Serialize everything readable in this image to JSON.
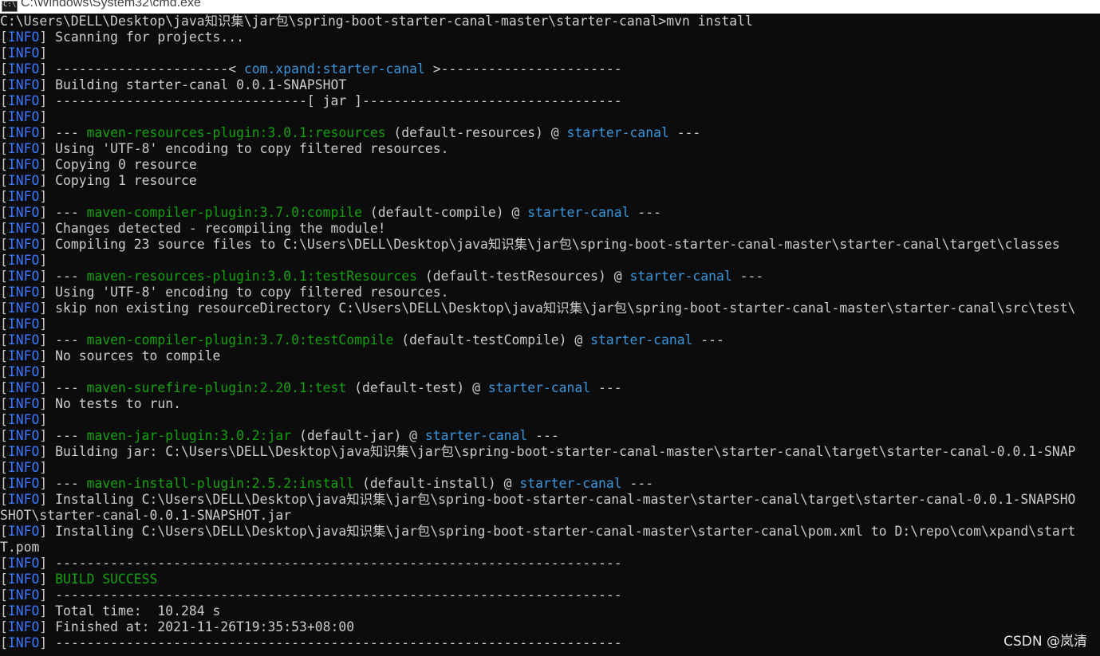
{
  "window": {
    "title": "C:\\Windows\\System32\\cmd.exe",
    "icon": "cmd-icon"
  },
  "colors": {
    "background": "#0c0c0c",
    "text": "#cccccc",
    "info": "#3b78ff",
    "plugin": "#13a10e",
    "artifact": "#3a96dd"
  },
  "console": {
    "lines": [
      {
        "segs": [
          {
            "t": "C:\\Users\\DELL\\Desktop\\java知识集\\jar包\\spring-boot-starter-canal-master\\starter-canal>mvn install",
            "c": "white"
          }
        ]
      },
      {
        "info": true,
        "segs": [
          {
            "t": " Scanning for projects...",
            "c": "white"
          }
        ]
      },
      {
        "info": true,
        "segs": []
      },
      {
        "info": true,
        "segs": [
          {
            "t": " ----------------------< ",
            "c": "white"
          },
          {
            "t": "com.xpand:starter-canal",
            "c": "cyan"
          },
          {
            "t": " >-----------------------",
            "c": "white"
          }
        ]
      },
      {
        "info": true,
        "segs": [
          {
            "t": " Building starter-canal 0.0.1-SNAPSHOT",
            "c": "white"
          }
        ]
      },
      {
        "info": true,
        "segs": [
          {
            "t": " --------------------------------[ jar ]---------------------------------",
            "c": "white"
          }
        ]
      },
      {
        "info": true,
        "segs": []
      },
      {
        "info": true,
        "segs": [
          {
            "t": " --- ",
            "c": "white"
          },
          {
            "t": "maven-resources-plugin:3.0.1:resources",
            "c": "green"
          },
          {
            "t": " (default-resources) @ ",
            "c": "white"
          },
          {
            "t": "starter-canal",
            "c": "cyan"
          },
          {
            "t": " ---",
            "c": "white"
          }
        ]
      },
      {
        "info": true,
        "segs": [
          {
            "t": " Using 'UTF-8' encoding to copy filtered resources.",
            "c": "white"
          }
        ]
      },
      {
        "info": true,
        "segs": [
          {
            "t": " Copying 0 resource",
            "c": "white"
          }
        ]
      },
      {
        "info": true,
        "segs": [
          {
            "t": " Copying 1 resource",
            "c": "white"
          }
        ]
      },
      {
        "info": true,
        "segs": []
      },
      {
        "info": true,
        "segs": [
          {
            "t": " --- ",
            "c": "white"
          },
          {
            "t": "maven-compiler-plugin:3.7.0:compile",
            "c": "green"
          },
          {
            "t": " (default-compile) @ ",
            "c": "white"
          },
          {
            "t": "starter-canal",
            "c": "cyan"
          },
          {
            "t": " ---",
            "c": "white"
          }
        ]
      },
      {
        "info": true,
        "segs": [
          {
            "t": " Changes detected - recompiling the module!",
            "c": "white"
          }
        ]
      },
      {
        "info": true,
        "segs": [
          {
            "t": " Compiling 23 source files to C:\\Users\\DELL\\Desktop\\java知识集\\jar包\\spring-boot-starter-canal-master\\starter-canal\\target\\classes",
            "c": "white"
          }
        ]
      },
      {
        "info": true,
        "segs": []
      },
      {
        "info": true,
        "segs": [
          {
            "t": " --- ",
            "c": "white"
          },
          {
            "t": "maven-resources-plugin:3.0.1:testResources",
            "c": "green"
          },
          {
            "t": " (default-testResources) @ ",
            "c": "white"
          },
          {
            "t": "starter-canal",
            "c": "cyan"
          },
          {
            "t": " ---",
            "c": "white"
          }
        ]
      },
      {
        "info": true,
        "segs": [
          {
            "t": " Using 'UTF-8' encoding to copy filtered resources.",
            "c": "white"
          }
        ]
      },
      {
        "info": true,
        "segs": [
          {
            "t": " skip non existing resourceDirectory C:\\Users\\DELL\\Desktop\\java知识集\\jar包\\spring-boot-starter-canal-master\\starter-canal\\src\\test\\",
            "c": "white"
          }
        ]
      },
      {
        "info": true,
        "segs": []
      },
      {
        "info": true,
        "segs": [
          {
            "t": " --- ",
            "c": "white"
          },
          {
            "t": "maven-compiler-plugin:3.7.0:testCompile",
            "c": "green"
          },
          {
            "t": " (default-testCompile) @ ",
            "c": "white"
          },
          {
            "t": "starter-canal",
            "c": "cyan"
          },
          {
            "t": " ---",
            "c": "white"
          }
        ]
      },
      {
        "info": true,
        "segs": [
          {
            "t": " No sources to compile",
            "c": "white"
          }
        ]
      },
      {
        "info": true,
        "segs": []
      },
      {
        "info": true,
        "segs": [
          {
            "t": " --- ",
            "c": "white"
          },
          {
            "t": "maven-surefire-plugin:2.20.1:test",
            "c": "green"
          },
          {
            "t": " (default-test) @ ",
            "c": "white"
          },
          {
            "t": "starter-canal",
            "c": "cyan"
          },
          {
            "t": " ---",
            "c": "white"
          }
        ]
      },
      {
        "info": true,
        "segs": [
          {
            "t": " No tests to run.",
            "c": "white"
          }
        ]
      },
      {
        "info": true,
        "segs": []
      },
      {
        "info": true,
        "segs": [
          {
            "t": " --- ",
            "c": "white"
          },
          {
            "t": "maven-jar-plugin:3.0.2:jar",
            "c": "green"
          },
          {
            "t": " (default-jar) @ ",
            "c": "white"
          },
          {
            "t": "starter-canal",
            "c": "cyan"
          },
          {
            "t": " ---",
            "c": "white"
          }
        ]
      },
      {
        "info": true,
        "segs": [
          {
            "t": " Building jar: C:\\Users\\DELL\\Desktop\\java知识集\\jar包\\spring-boot-starter-canal-master\\starter-canal\\target\\starter-canal-0.0.1-SNAP",
            "c": "white"
          }
        ]
      },
      {
        "info": true,
        "segs": []
      },
      {
        "info": true,
        "segs": [
          {
            "t": " --- ",
            "c": "white"
          },
          {
            "t": "maven-install-plugin:2.5.2:install",
            "c": "green"
          },
          {
            "t": " (default-install) @ ",
            "c": "white"
          },
          {
            "t": "starter-canal",
            "c": "cyan"
          },
          {
            "t": " ---",
            "c": "white"
          }
        ]
      },
      {
        "info": true,
        "segs": [
          {
            "t": " Installing C:\\Users\\DELL\\Desktop\\java知识集\\jar包\\spring-boot-starter-canal-master\\starter-canal\\target\\starter-canal-0.0.1-SNAPSHO",
            "c": "white"
          }
        ]
      },
      {
        "segs": [
          {
            "t": "SHOT\\starter-canal-0.0.1-SNAPSHOT.jar",
            "c": "white"
          }
        ]
      },
      {
        "info": true,
        "segs": [
          {
            "t": " Installing C:\\Users\\DELL\\Desktop\\java知识集\\jar包\\spring-boot-starter-canal-master\\starter-canal\\pom.xml to D:\\repo\\com\\xpand\\start",
            "c": "white"
          }
        ]
      },
      {
        "segs": [
          {
            "t": "T.pom",
            "c": "white"
          }
        ]
      },
      {
        "info": true,
        "segs": [
          {
            "t": " ------------------------------------------------------------------------",
            "c": "white"
          }
        ]
      },
      {
        "info": true,
        "segs": [
          {
            "t": " ",
            "c": "white"
          },
          {
            "t": "BUILD SUCCESS",
            "c": "green"
          }
        ]
      },
      {
        "info": true,
        "segs": [
          {
            "t": " ------------------------------------------------------------------------",
            "c": "white"
          }
        ]
      },
      {
        "info": true,
        "segs": [
          {
            "t": " Total time:  10.284 s",
            "c": "white"
          }
        ]
      },
      {
        "info": true,
        "segs": [
          {
            "t": " Finished at: 2021-11-26T19:35:53+08:00",
            "c": "white"
          }
        ]
      },
      {
        "info": true,
        "segs": [
          {
            "t": " ------------------------------------------------------------------------",
            "c": "white"
          }
        ]
      }
    ]
  },
  "info_tag": "INFO",
  "watermark": "CSDN @岚清"
}
